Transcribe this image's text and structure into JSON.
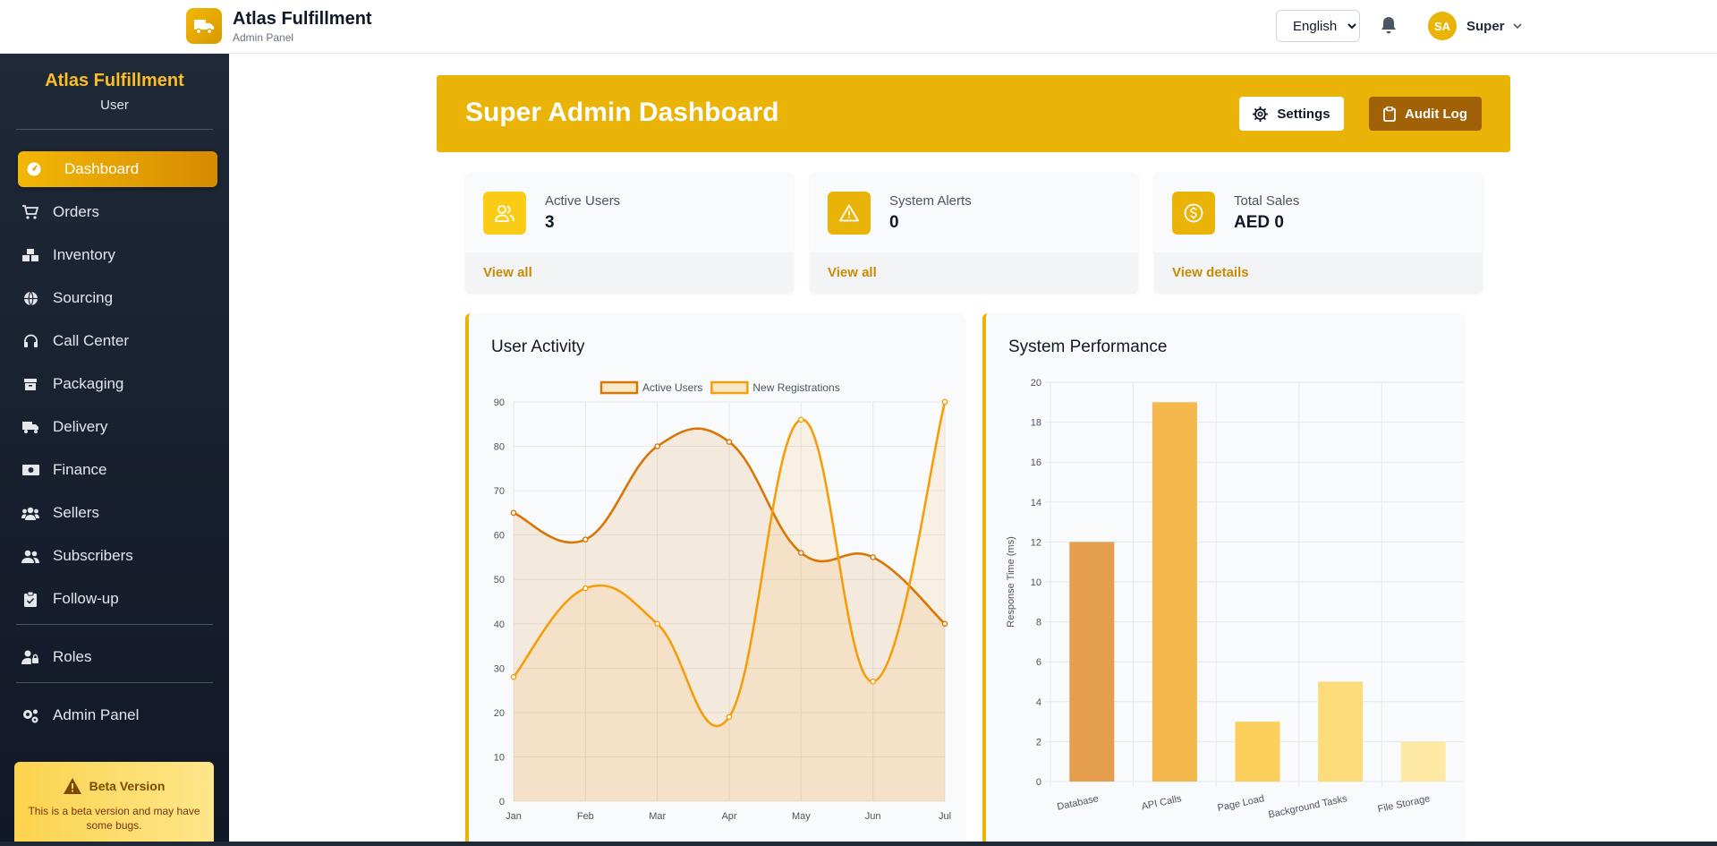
{
  "header": {
    "brand_title": "Atlas Fulfillment",
    "brand_subtitle": "Admin Panel",
    "language": "English",
    "language_options": [
      "English"
    ],
    "user_initials": "SA",
    "user_name": "Super"
  },
  "sidebar": {
    "title": "Atlas Fulfillment",
    "subtitle": "User",
    "items": [
      {
        "label": "Dashboard",
        "icon": "dashboard-icon",
        "active": true
      },
      {
        "label": "Orders",
        "icon": "cart-icon"
      },
      {
        "label": "Inventory",
        "icon": "boxes-icon"
      },
      {
        "label": "Sourcing",
        "icon": "globe-icon"
      },
      {
        "label": "Call Center",
        "icon": "headset-icon"
      },
      {
        "label": "Packaging",
        "icon": "box-icon"
      },
      {
        "label": "Delivery",
        "icon": "truck-icon"
      },
      {
        "label": "Finance",
        "icon": "money-icon"
      },
      {
        "label": "Sellers",
        "icon": "users-icon"
      },
      {
        "label": "Subscribers",
        "icon": "user-group-icon"
      },
      {
        "label": "Follow-up",
        "icon": "clipboard-check-icon"
      },
      {
        "label": "Roles",
        "icon": "user-lock-icon"
      },
      {
        "label": "Admin Panel",
        "icon": "gears-icon"
      }
    ],
    "beta_title": "Beta Version",
    "beta_text": "This is a beta version and may have some bugs."
  },
  "banner": {
    "title": "Super Admin Dashboard",
    "settings_label": "Settings",
    "audit_label": "Audit Log"
  },
  "stats": [
    {
      "label": "Active Users",
      "value": "3",
      "link": "View all",
      "icon": "users-icon"
    },
    {
      "label": "System Alerts",
      "value": "0",
      "link": "View all",
      "icon": "warning-icon"
    },
    {
      "label": "Total Sales",
      "value": "AED 0",
      "link": "View details",
      "icon": "dollar-icon"
    }
  ],
  "colors": {
    "accent": "#eab308",
    "accent_dark": "#a16207",
    "sidebar_bg": "#1f2937",
    "link": "#ca8a04"
  },
  "panels": {
    "user_activity_title": "User Activity",
    "system_performance_title": "System Performance"
  },
  "chart_data": [
    {
      "type": "line",
      "categories": [
        "Jan",
        "Feb",
        "Mar",
        "Apr",
        "May",
        "Jun",
        "Jul"
      ],
      "series": [
        {
          "name": "Active Users",
          "values": [
            65,
            59,
            80,
            81,
            56,
            55,
            40
          ],
          "color": "#d97706"
        },
        {
          "name": "New Registrations",
          "values": [
            28,
            48,
            40,
            19,
            86,
            27,
            90
          ],
          "color": "#f59e0b"
        }
      ],
      "ylim": [
        0,
        90
      ],
      "yticks": [
        0,
        10,
        20,
        30,
        40,
        50,
        60,
        70,
        80,
        90
      ],
      "grid": true,
      "legend": "top-center"
    },
    {
      "type": "bar",
      "categories": [
        "Database",
        "API Calls",
        "Page Load",
        "Background Tasks",
        "File Storage"
      ],
      "values": [
        12,
        19,
        3,
        5,
        2
      ],
      "colors": [
        "#e49e4d",
        "#f4b84d",
        "#fbcf5b",
        "#fcdb7a",
        "#fde9a3"
      ],
      "ylabel": "Response Time (ms)",
      "ylim": [
        0,
        20
      ],
      "yticks": [
        0,
        2,
        4,
        6,
        8,
        10,
        12,
        14,
        16,
        18,
        20
      ],
      "grid": true
    }
  ]
}
